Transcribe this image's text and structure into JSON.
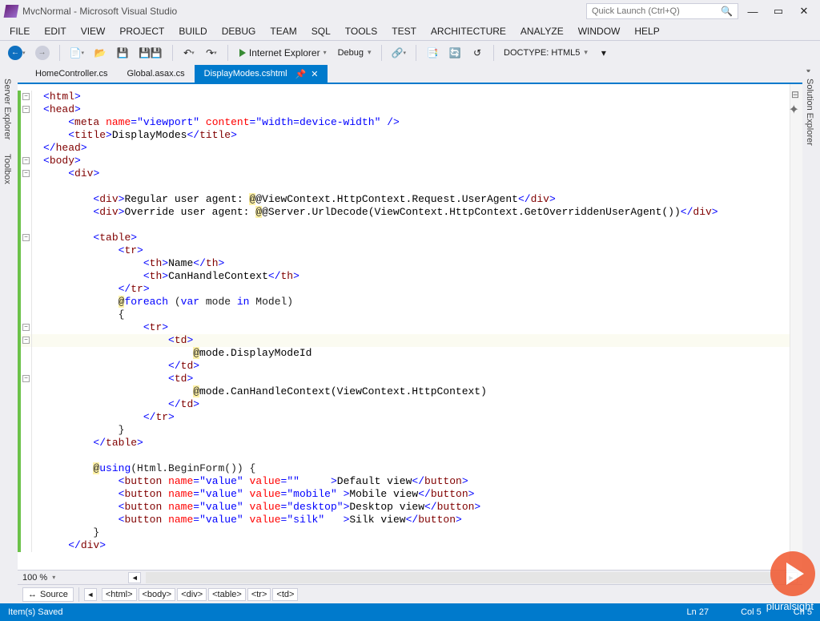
{
  "window": {
    "title": "MvcNormal - Microsoft Visual Studio",
    "quick_launch_placeholder": "Quick Launch (Ctrl+Q)"
  },
  "menu": [
    "FILE",
    "EDIT",
    "VIEW",
    "PROJECT",
    "BUILD",
    "DEBUG",
    "TEAM",
    "SQL",
    "TOOLS",
    "TEST",
    "ARCHITECTURE",
    "ANALYZE",
    "WINDOW",
    "HELP"
  ],
  "toolbar": {
    "debug_target": "Internet Explorer",
    "config": "Debug",
    "doctype": "DOCTYPE: HTML5"
  },
  "tabs": [
    {
      "label": "HomeController.cs",
      "active": false
    },
    {
      "label": "Global.asax.cs",
      "active": false
    },
    {
      "label": "DisplayModes.cshtml",
      "active": true
    }
  ],
  "dock_left": [
    "Server Explorer",
    "Toolbox"
  ],
  "dock_right": [
    "Solution Explorer"
  ],
  "zoom": "100 %",
  "source_btn": "Source",
  "breadcrumb": [
    "<html>",
    "<body>",
    "<div>",
    "<table>",
    "<tr>",
    "<td>"
  ],
  "statusbar": {
    "msg": "Item(s) Saved",
    "ln": "Ln 27",
    "col": "Col 5",
    "ch": "Ch 5"
  },
  "watermark": "pluralsight",
  "code": {
    "plain1": "DisplayModes",
    "plain2": "Regular user agent: ",
    "plain3": "Override user agent: ",
    "ra1": "@ViewContext.HttpContext.Request.UserAgent",
    "ra2": "@Server.UrlDecode(ViewContext.HttpContext.GetOverriddenUserAgent())",
    "th1": "Name",
    "th2": "CanHandleContext",
    "foreach_kw": "foreach",
    "foreach_var": "var",
    "foreach_in": "in",
    "foreach_mdl": "Model",
    "foreach_obj": "mode",
    "mode_id": "mode.DisplayModeId",
    "mode_can": "mode.CanHandleContext(ViewContext.HttpContext)",
    "using_kw": "using",
    "using_expr": "(Html.BeginForm()) {",
    "btn1_txt": "Default view",
    "btn2_txt": "Mobile view",
    "btn3_txt": "Desktop view",
    "btn4_txt": "Silk view",
    "attr_name": "name",
    "attr_value": "value",
    "val_value": "\"value\"",
    "val_empty": "\"\"",
    "val_mobile": "\"mobile\"",
    "val_desktop": "\"desktop\"",
    "val_silk": "\"silk\"",
    "meta_name_attr": "name",
    "meta_name_val": "\"viewport\"",
    "meta_content_attr": "content",
    "meta_content_val": "\"width=device-width\""
  }
}
